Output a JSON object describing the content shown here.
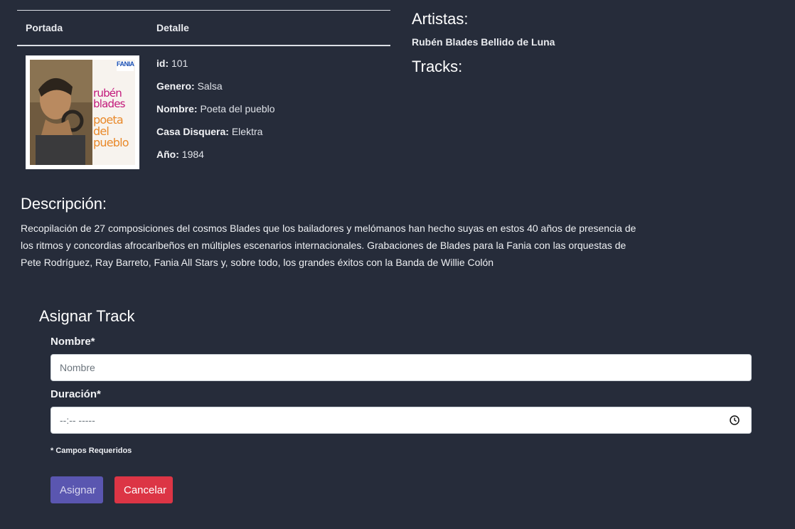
{
  "table": {
    "headers": {
      "cover": "Portada",
      "detail": "Detalle"
    },
    "cover": {
      "label": "FANIA",
      "artist_line1": "rubén",
      "artist_line2": "blades",
      "title_line1": "poeta",
      "title_line2": "del",
      "title_line3": "pueblo"
    },
    "details": [
      {
        "key": "id:",
        "value": "101"
      },
      {
        "key": "Genero:",
        "value": "Salsa"
      },
      {
        "key": "Nombre:",
        "value": "Poeta del pueblo"
      },
      {
        "key": "Casa Disquera:",
        "value": "Elektra"
      },
      {
        "key": "Año:",
        "value": "1984"
      }
    ]
  },
  "artists": {
    "title": "Artistas:",
    "list": "Rubén Blades Bellido de Luna"
  },
  "tracks": {
    "title": "Tracks:"
  },
  "description": {
    "title": "Descripción:",
    "line1": "Recopilación de 27 composiciones del cosmos Blades que los bailadores y melómanos han hecho suyas en estos 40 años de presencia de",
    "line2": "los ritmos y concordias afrocaribeños en múltiples escenarios internacionales. Grabaciones de Blades para la Fania con las orquestas de",
    "line3": "Pete Rodríguez, Ray Barreto, Fania All Stars y, sobre todo, los grandes éxitos con la Banda de Willie Colón"
  },
  "form": {
    "title": "Asignar Track",
    "nombre_label": "Nombre*",
    "nombre_placeholder": "Nombre",
    "duracion_label": "Duración*",
    "duracion_placeholder": "--:-- -----",
    "required_note": "* Campos Requeridos",
    "assign_label": "Asignar",
    "cancel_label": "Cancelar"
  },
  "colors": {
    "background": "#262c3a",
    "assign_button": "#5a56b0",
    "cancel_button": "#dc3545"
  }
}
